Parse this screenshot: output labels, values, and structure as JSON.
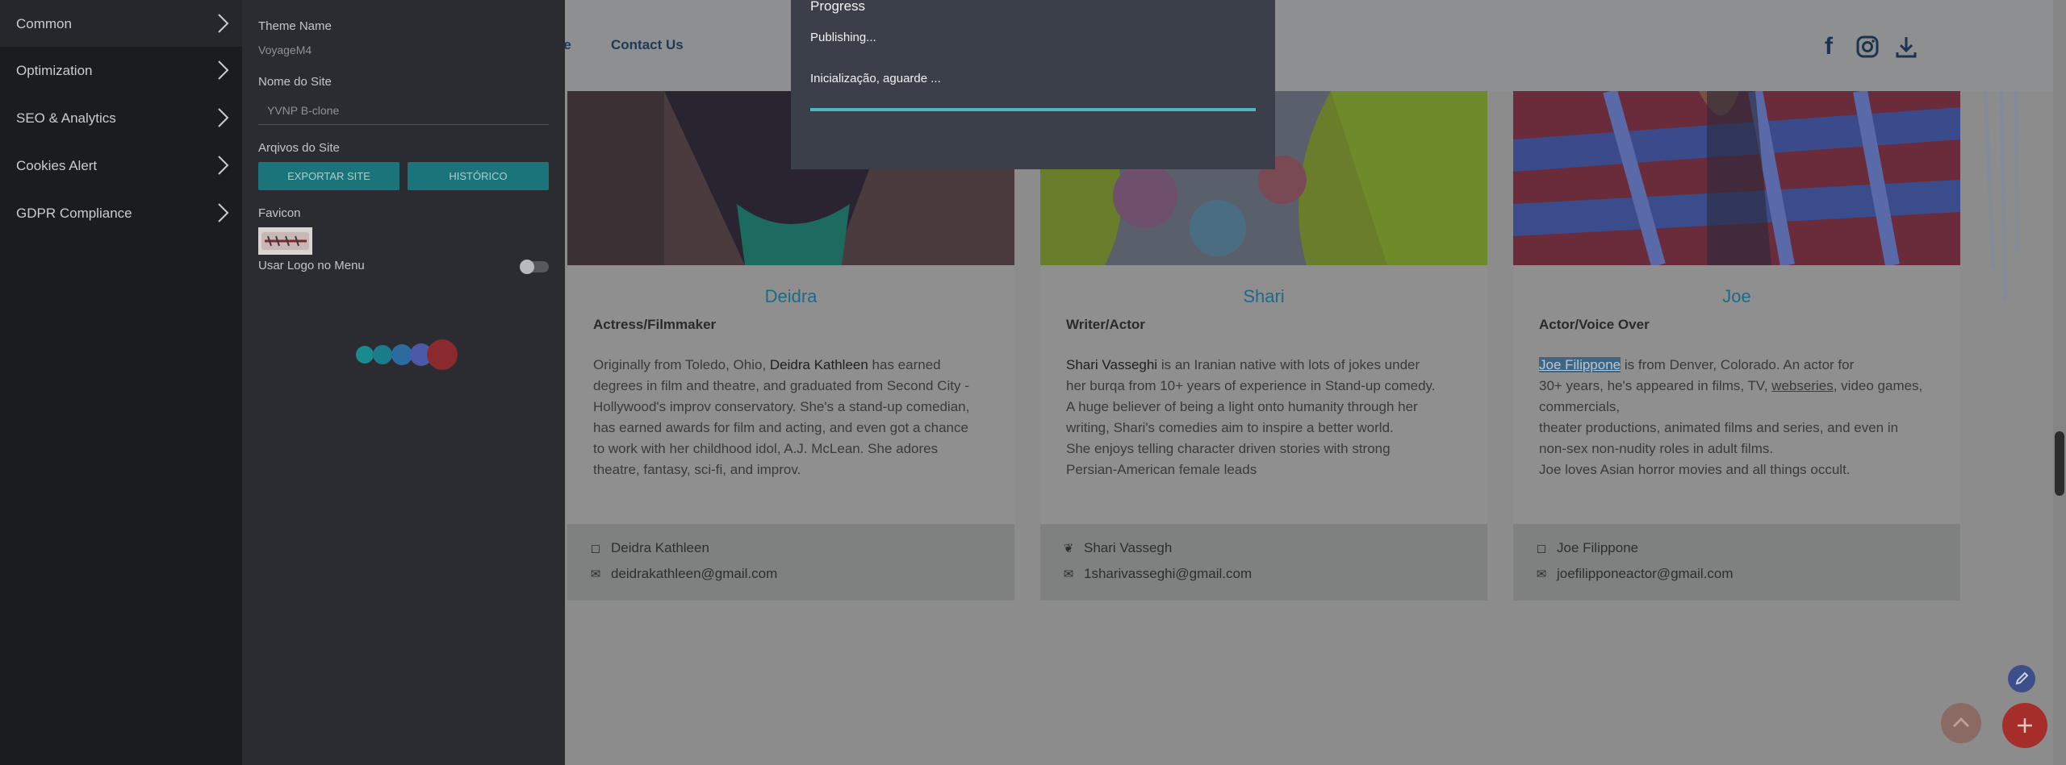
{
  "nav": {
    "links": [
      "pe",
      "Contact Us"
    ],
    "social_icons": [
      "facebook-icon",
      "instagram-icon",
      "download-icon"
    ]
  },
  "cards": [
    {
      "name": "Deidra",
      "role": "Actress/Filmmaker",
      "bio_lines": [
        [
          "Originally from Toledo, Ohio, ",
          "Deidra Kathleen",
          " has earned"
        ],
        [
          "degrees in film and theatre, and graduated from Second City -"
        ],
        [
          "Hollywood's improv conservatory. She's a stand-up comedian,"
        ],
        [
          "has earned awards for film and acting, and even got a chance"
        ],
        [
          "to work with her childhood idol, A.J. McLean. She adores"
        ],
        [
          "theatre, fantasy, sci-fi, and improv."
        ]
      ],
      "social_icon": "instagram-icon",
      "social": "Deidra Kathleen",
      "email": "deidrakathleen@gmail.com"
    },
    {
      "name": "Shari",
      "role": "Writer/Actor",
      "bio_lines": [
        [
          "",
          "Shari Vasseghi",
          " is an Iranian native with lots of jokes under"
        ],
        [
          "her burqa from 10+ years of experience in Stand-up comedy."
        ],
        [
          "A huge believer of being a light onto humanity through her"
        ],
        [
          "writing, Shari's comedies aim to inspire a better world."
        ],
        [
          "She enjoys telling character driven stories with strong"
        ],
        [
          "Persian-American female leads"
        ]
      ],
      "social_icon": "twitter-icon",
      "social": "Shari Vassegh",
      "email": "1sharivasseghi@gmail.com"
    },
    {
      "name": "Joe",
      "role": "Actor/Voice Over",
      "bio_lines": [
        [
          "",
          "Joe Filippone",
          " is from Denver, Colorado. An actor for"
        ],
        [
          "30+ years, he's appeared in films, TV, ",
          "webseries",
          ", video games,"
        ],
        [
          "commercials,"
        ],
        [
          "theater productions, animated films and series, and even in"
        ],
        [
          "non-sex non-nudity roles in adult films."
        ],
        [
          "Joe loves Asian horror movies and all things occult."
        ]
      ],
      "social_icon": "instagram-icon",
      "social": "Joe Filippone",
      "email": "joefilipponeactor@gmail.com"
    }
  ],
  "menu": {
    "items": [
      "Common",
      "Optimization",
      "SEO & Analytics",
      "Cookies Alert",
      "GDPR Compliance"
    ],
    "active_index": 0
  },
  "panel": {
    "theme_label": "Theme Name",
    "theme_value": "VoyageM4",
    "site_name_label": "Nome do Site",
    "site_name_value": "YVNP B-clone",
    "files_label": "Arqivos do Site",
    "export_button": "EXPORTAR SITE",
    "history_button": "HISTÓRICO",
    "favicon_label": "Favicon",
    "logo_menu_label": "Usar Logo no Menu",
    "logo_menu_enabled": false
  },
  "modal": {
    "title": "Progress",
    "status": "Publishing...",
    "message": "Inicialização, aguarde ...",
    "progress": 1.0
  },
  "colors": {
    "accent": "#1b7479",
    "progress": "#4bb7c4",
    "fab_add": "#a52e2a",
    "fab_edit": "#3c4f88"
  }
}
